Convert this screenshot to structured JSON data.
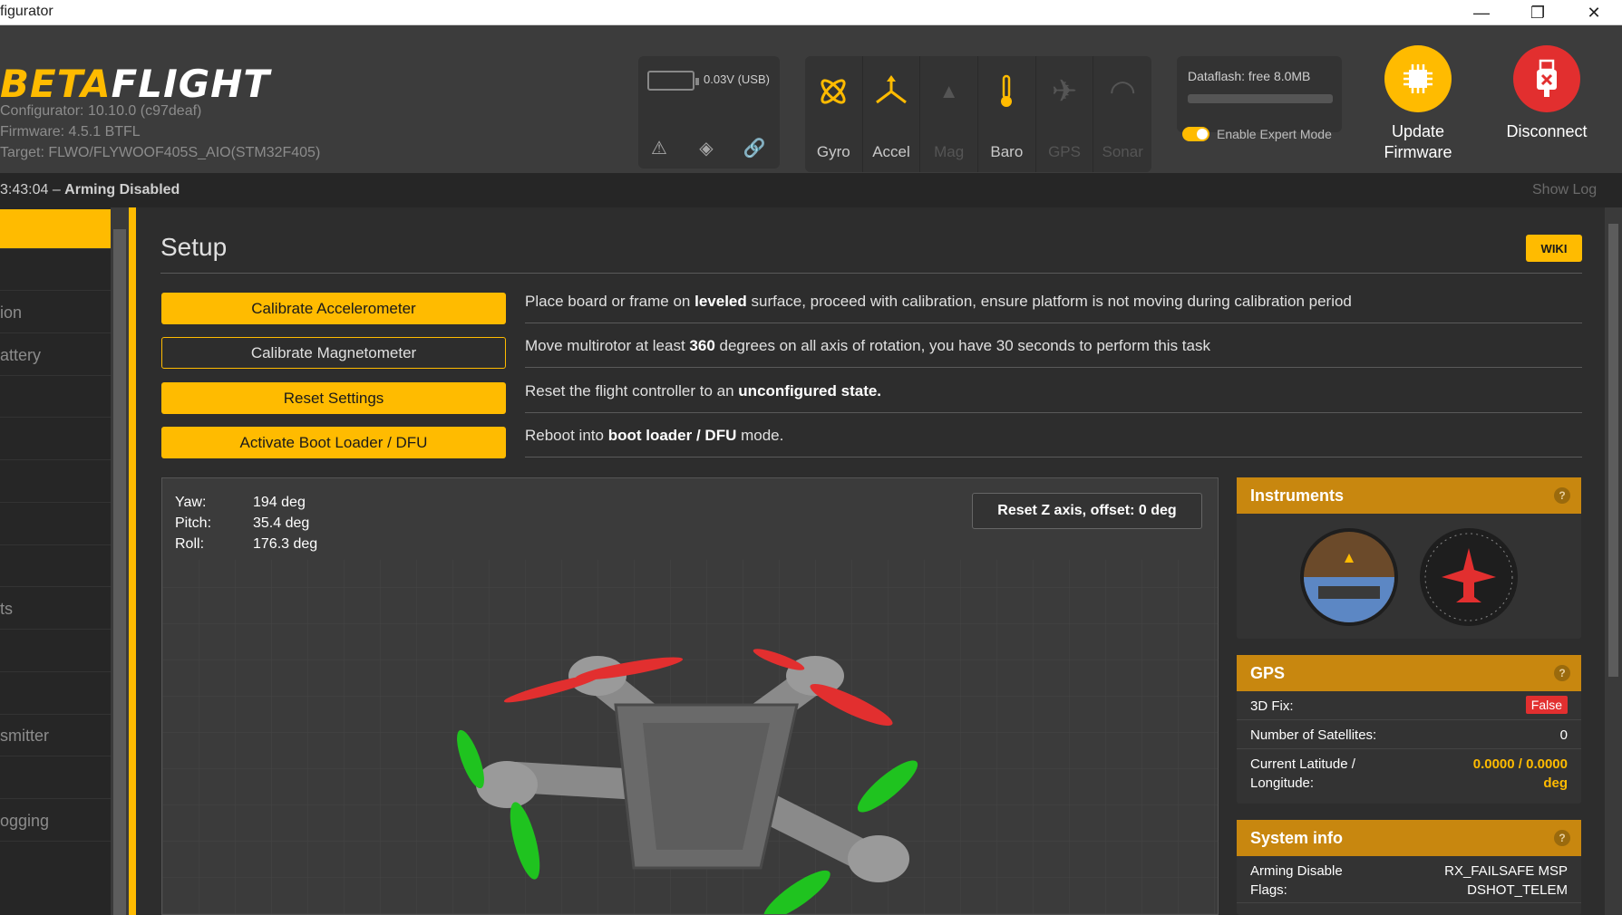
{
  "window": {
    "title": "figurator",
    "minimize": "—",
    "maximize": "❐",
    "close": "✕"
  },
  "header": {
    "logo_part1": "BETA",
    "logo_part2": "FLIGHT",
    "configurator": "Configurator: 10.10.0 (c97deaf)",
    "firmware": "Firmware: 4.5.1 BTFL",
    "target": "Target: FLWO/FLYWOOF405S_AIO(STM32F405)",
    "battery": "0.03V (USB)",
    "sensors": [
      {
        "name": "gyro",
        "label": "Gyro",
        "active": true
      },
      {
        "name": "accel",
        "label": "Accel",
        "active": true
      },
      {
        "name": "mag",
        "label": "Mag",
        "active": false
      },
      {
        "name": "baro",
        "label": "Baro",
        "active": true
      },
      {
        "name": "gps",
        "label": "GPS",
        "active": false
      },
      {
        "name": "sonar",
        "label": "Sonar",
        "active": false
      }
    ],
    "dataflash": "Dataflash: free 8.0MB",
    "expert_mode": "Enable Expert Mode",
    "update_firmware_line1": "Update",
    "update_firmware_line2": "Firmware",
    "disconnect": "Disconnect"
  },
  "status": {
    "time": "3:43:04 – ",
    "state": "Arming Disabled",
    "show_log": "Show Log"
  },
  "sidebar": {
    "items": [
      "",
      "",
      "ion",
      "attery",
      "",
      "",
      "",
      "",
      "",
      "ts",
      "",
      "",
      "smitter",
      "",
      "ogging"
    ]
  },
  "setup": {
    "title": "Setup",
    "wiki": "WIKI",
    "actions": [
      {
        "label": "Calibrate Accelerometer",
        "pre": "Place board or frame on ",
        "bold": "leveled",
        "post": " surface, proceed with calibration, ensure platform is not moving during calibration period"
      },
      {
        "label": "Calibrate Magnetometer",
        "pre": "Move multirotor at least ",
        "bold": "360",
        "post": " degrees on all axis of rotation, you have 30 seconds to perform this task"
      },
      {
        "label": "Reset Settings",
        "pre": "Reset the flight controller to an ",
        "bold": "unconfigured state.",
        "post": ""
      },
      {
        "label": "Activate Boot Loader / DFU",
        "pre": "Reboot into ",
        "bold": "boot loader / DFU",
        "post": " mode."
      }
    ],
    "attitude": {
      "yaw_label": "Yaw:",
      "yaw": "194 deg",
      "pitch_label": "Pitch:",
      "pitch": "35.4 deg",
      "roll_label": "Roll:",
      "roll": "176.3 deg"
    },
    "reset_z": "Reset Z axis, offset: 0 deg"
  },
  "instruments": {
    "title": "Instruments",
    "help": "?"
  },
  "gps": {
    "title": "GPS",
    "help": "?",
    "fix_label": "3D Fix:",
    "fix_value": "False",
    "sats_label": "Number of Satellites:",
    "sats_value": "0",
    "latlon_label1": "Current Latitude /",
    "latlon_label2": "Longitude:",
    "latlon_value": "0.0000 / 0.0000",
    "latlon_unit": "deg"
  },
  "sysinfo": {
    "title": "System info",
    "help": "?",
    "arming_label1": "Arming Disable",
    "arming_label2": "Flags:",
    "arming_value1": "RX_FAILSAFE MSP",
    "arming_value2": "DSHOT_TELEM"
  },
  "colors": {
    "accent": "#ffbb00",
    "disconnect": "#e22f2f",
    "update": "#ffbb00"
  }
}
